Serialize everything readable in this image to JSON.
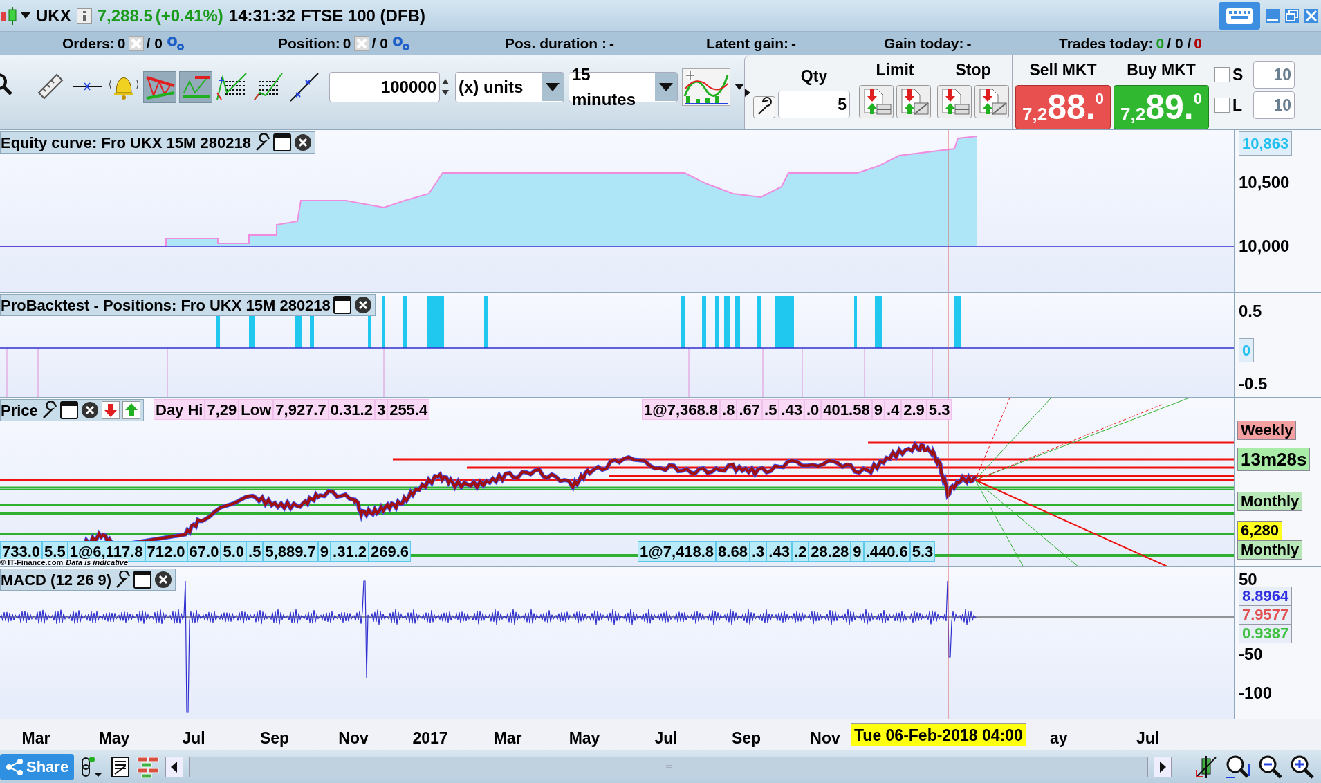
{
  "title_bar": {
    "symbol": "UKX",
    "price": "7,288.5",
    "change": "(+0.41%)",
    "time": "14:31:32",
    "name": "FTSE 100 (DFB)"
  },
  "status": {
    "orders": {
      "label": "Orders:",
      "value": "0",
      "total": "/ 0"
    },
    "position": {
      "label": "Position:",
      "value": "0",
      "total": "/ 0"
    },
    "pos_duration": {
      "label": "Pos. duration :",
      "value": "-"
    },
    "latent_gain": {
      "label": "Latent gain:",
      "value": "-"
    },
    "gain_today": {
      "label": "Gain today:",
      "value": "-"
    },
    "trades_today": {
      "label": "Trades today:",
      "parts": [
        {
          "text": "0",
          "color": "#1a9a1a"
        },
        {
          "text": "/ 0 /",
          "color": "#000000"
        },
        {
          "text": "0",
          "color": "#b00000"
        }
      ]
    }
  },
  "toolbar": {
    "tools": [
      {
        "kind": "zoom",
        "selected": false
      },
      {
        "kind": "ruler",
        "selected": false
      },
      {
        "kind": "hline",
        "selected": false
      },
      {
        "kind": "alert",
        "selected": false
      },
      {
        "kind": "channel",
        "selected": true
      },
      {
        "kind": "trend",
        "selected": true
      },
      {
        "kind": "levels",
        "selected": false
      },
      {
        "kind": "levels2",
        "selected": false
      },
      {
        "kind": "line",
        "selected": false
      }
    ],
    "amount": "100000",
    "unit": "(x) units",
    "timeframe": "15 minutes"
  },
  "order_panel": {
    "qty_label": "Qty",
    "qty": "5",
    "limit_label": "Limit",
    "stop_label": "Stop",
    "sell": {
      "label": "Sell MKT",
      "prefix": "7,2",
      "big": "88.",
      "sup": "0"
    },
    "buy": {
      "label": "Buy MKT",
      "prefix": "7,2",
      "big": "89.",
      "sup": "0"
    },
    "sides": [
      {
        "label": "S",
        "checked": false,
        "value": "10"
      },
      {
        "label": "L",
        "checked": false,
        "value": "10"
      }
    ]
  },
  "equity": {
    "title": "Equity curve: Fro UKX 15M  280218",
    "current": "10,863",
    "ticks": [
      "10,500",
      "10,000"
    ]
  },
  "positions": {
    "title": "ProBacktest - Positions: Fro UKX 15M  280218",
    "current": "0",
    "ticks": [
      "0.5",
      "-0.5"
    ]
  },
  "price": {
    "title": "Price",
    "copyright": "© IT-Finance.com",
    "note": "Data is indicative",
    "top_labels": [
      "Day Hi",
      "7,29",
      "Low",
      "7,927.7",
      "0.31.2",
      "3",
      "255.4",
      "1@7,368.8",
      ".8",
      ".67",
      ".5",
      ".43",
      ".0",
      "401.58",
      "9",
      ".4",
      "2.9",
      "5.3"
    ],
    "bottom_labels": [
      "733.0",
      "5.5",
      "1@6,117.8",
      "712.0",
      "67.0",
      "5.0",
      ".5",
      "5,889.7",
      "9",
      ".31.2",
      "269.6",
      "1@7,418.8",
      "8.68",
      ".3",
      ".43",
      ".2",
      "28.28",
      "9",
      ".440.6",
      "5.3"
    ],
    "tags": [
      {
        "text": "Weekly",
        "color": "#f4a0a0"
      },
      {
        "text": "13m28s",
        "color": "#a8eca8"
      },
      {
        "text": "Monthly",
        "color": "#b8e8b8"
      },
      {
        "text": "6,280",
        "color": "#ffff20"
      },
      {
        "text": "Monthly",
        "color": "#b8e8b8"
      }
    ]
  },
  "macd": {
    "title": "MACD (12 26 9)",
    "ticks": [
      "50",
      "-50",
      "-100"
    ],
    "values": [
      {
        "text": "8.8964",
        "color": "#3030e0"
      },
      {
        "text": "7.9577",
        "color": "#e05050"
      },
      {
        "text": "0.9387",
        "color": "#40c040"
      }
    ]
  },
  "x_axis": {
    "labels": [
      "Mar",
      "May",
      "Jul",
      "Sep",
      "Nov",
      "2017",
      "Mar",
      "May",
      "Jul",
      "Sep",
      "Nov"
    ],
    "cursor": "Tue 06-Feb-2018 04:00",
    "after": [
      "ay",
      "Jul"
    ]
  },
  "bottom_bar": {
    "share": "Share"
  }
}
